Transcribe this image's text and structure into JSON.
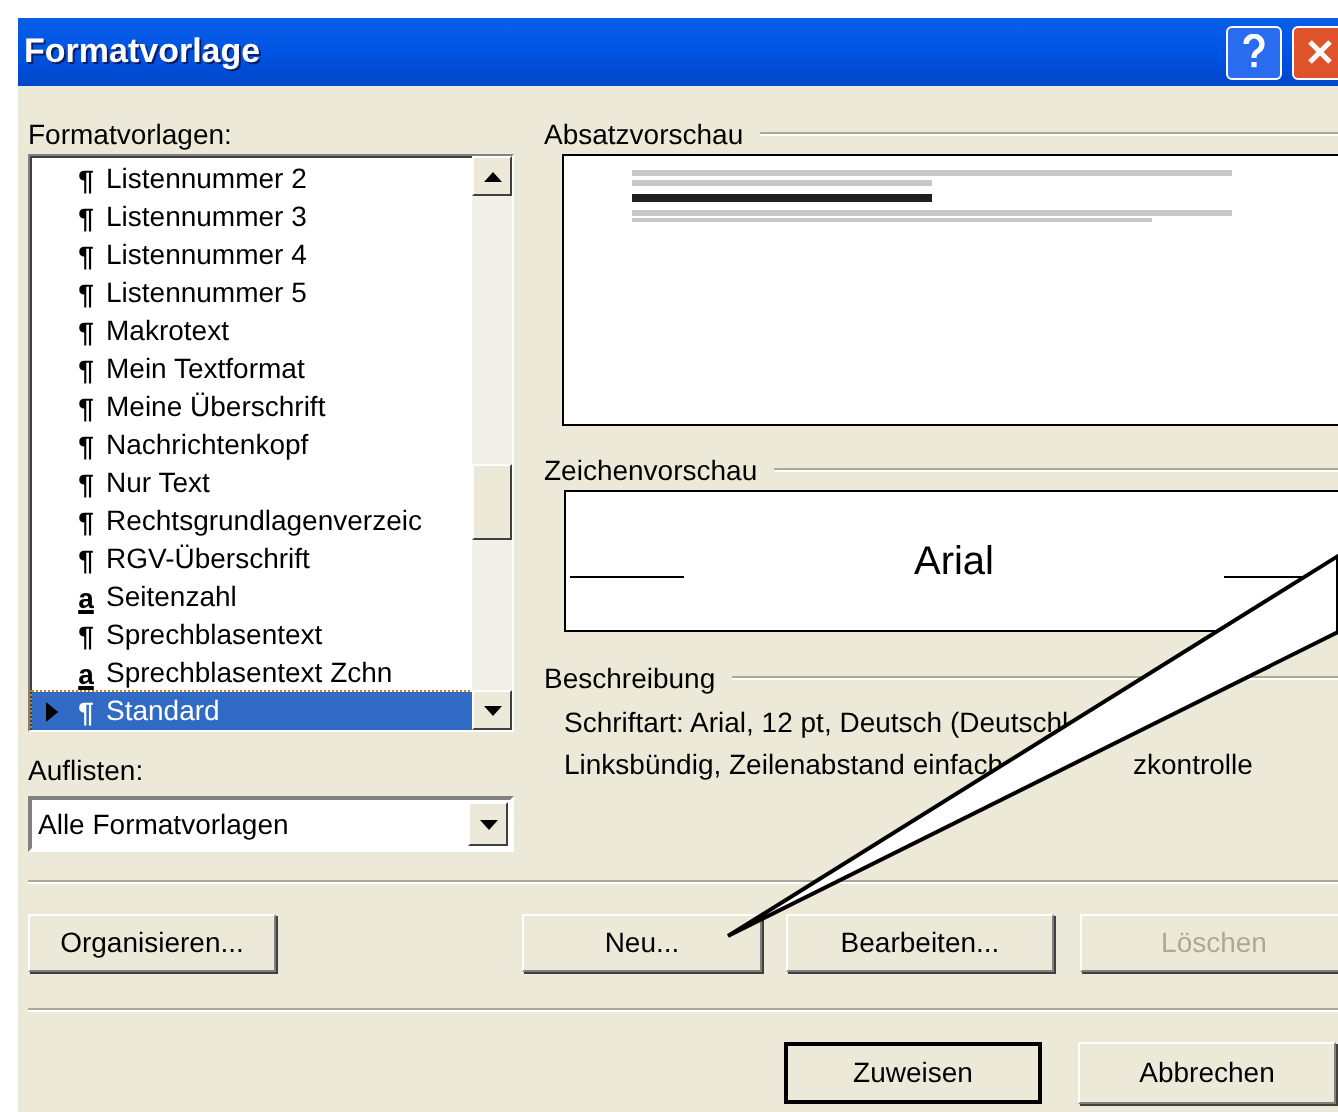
{
  "window": {
    "title": "Formatvorlage"
  },
  "styles_label": "Formatvorlagen:",
  "styles": [
    {
      "kind": "paragraph",
      "symbol": "¶",
      "label": "Listennummer 2",
      "selected": false
    },
    {
      "kind": "paragraph",
      "symbol": "¶",
      "label": "Listennummer 3",
      "selected": false
    },
    {
      "kind": "paragraph",
      "symbol": "¶",
      "label": "Listennummer 4",
      "selected": false
    },
    {
      "kind": "paragraph",
      "symbol": "¶",
      "label": "Listennummer 5",
      "selected": false
    },
    {
      "kind": "paragraph",
      "symbol": "¶",
      "label": "Makrotext",
      "selected": false
    },
    {
      "kind": "paragraph",
      "symbol": "¶",
      "label": "Mein Textformat",
      "selected": false
    },
    {
      "kind": "paragraph",
      "symbol": "¶",
      "label": "Meine Überschrift",
      "selected": false
    },
    {
      "kind": "paragraph",
      "symbol": "¶",
      "label": "Nachrichtenkopf",
      "selected": false
    },
    {
      "kind": "paragraph",
      "symbol": "¶",
      "label": "Nur Text",
      "selected": false
    },
    {
      "kind": "paragraph",
      "symbol": "¶",
      "label": "Rechtsgrundlagenverzeic",
      "selected": false
    },
    {
      "kind": "paragraph",
      "symbol": "¶",
      "label": "RGV-Überschrift",
      "selected": false
    },
    {
      "kind": "character",
      "symbol": "a",
      "label": "Seitenzahl",
      "selected": false
    },
    {
      "kind": "paragraph",
      "symbol": "¶",
      "label": "Sprechblasentext",
      "selected": false
    },
    {
      "kind": "character",
      "symbol": "a",
      "label": "Sprechblasentext Zchn",
      "selected": false
    },
    {
      "kind": "paragraph",
      "symbol": "¶",
      "label": "Standard",
      "selected": true
    }
  ],
  "list_label": "Auflisten:",
  "list_value": "Alle Formatvorlagen",
  "paragraph_preview": {
    "label": "Absatzvorschau"
  },
  "character_preview": {
    "label": "Zeichenvorschau",
    "sample": "Arial"
  },
  "description": {
    "label": "Beschreibung",
    "line_1": "Schriftart: Arial, 12 pt, Deutsch (Deutschl",
    "line_2": "Linksbündig, Zeilenabstand einfach",
    "line_2_end": "zkontrolle"
  },
  "buttons": [
    {
      "label": "Organisieren...",
      "disabled": false
    },
    {
      "label": "Neu...",
      "disabled": false
    },
    {
      "label": "Bearbeiten...",
      "disabled": false
    },
    {
      "label": "Löschen",
      "disabled": true
    }
  ],
  "dialog_buttons": [
    {
      "label": "Zuweisen",
      "default": true
    },
    {
      "label": "Abbrechen",
      "default": false
    }
  ]
}
